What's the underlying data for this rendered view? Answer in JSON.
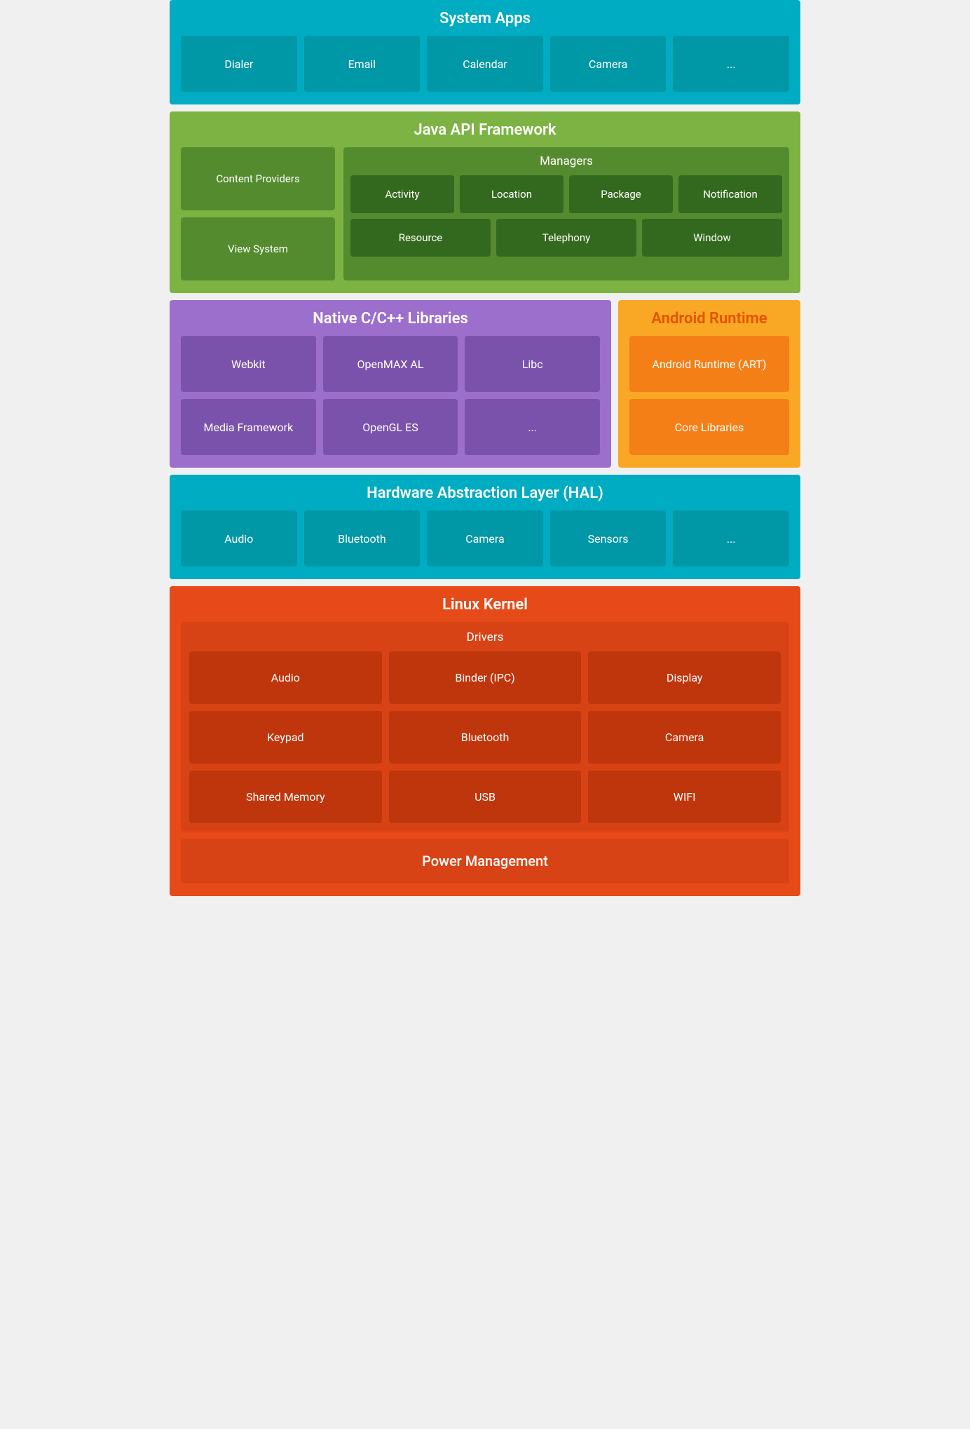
{
  "system_apps": {
    "title": "System Apps",
    "tiles": [
      "Dialer",
      "Email",
      "Calendar",
      "Camera",
      "..."
    ]
  },
  "java_api": {
    "title": "Java API Framework",
    "left": [
      "Content Providers",
      "View System"
    ],
    "managers": {
      "title": "Managers",
      "row1": [
        "Activity",
        "Location",
        "Package",
        "Notification"
      ],
      "row2": [
        "Resource",
        "Telephony",
        "Window"
      ]
    }
  },
  "native_libs": {
    "title": "Native C/C++ Libraries",
    "tiles": [
      "Webkit",
      "OpenMAX AL",
      "Libc",
      "Media Framework",
      "OpenGL ES",
      "..."
    ]
  },
  "android_runtime": {
    "title": "Android Runtime",
    "tiles": [
      "Android Runtime (ART)",
      "Core Libraries"
    ]
  },
  "hal": {
    "title": "Hardware Abstraction Layer (HAL)",
    "tiles": [
      "Audio",
      "Bluetooth",
      "Camera",
      "Sensors",
      "..."
    ]
  },
  "linux_kernel": {
    "title": "Linux Kernel",
    "drivers": {
      "title": "Drivers",
      "tiles": [
        "Audio",
        "Binder (IPC)",
        "Display",
        "Keypad",
        "Bluetooth",
        "Camera",
        "Shared Memory",
        "USB",
        "WIFI"
      ]
    },
    "power_management": "Power Management"
  }
}
